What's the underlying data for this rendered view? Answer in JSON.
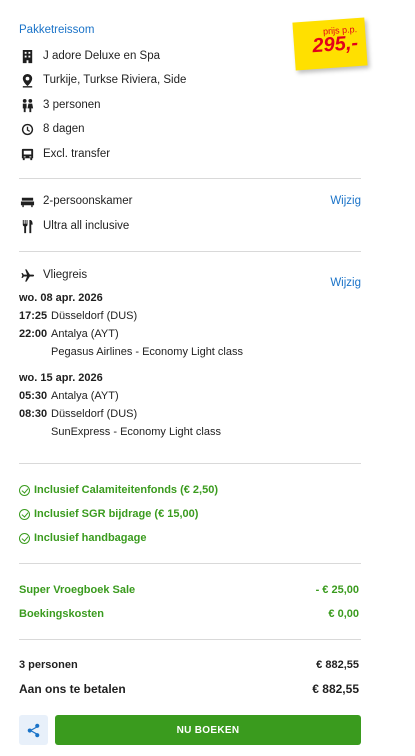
{
  "package": {
    "title": "Pakketreissom",
    "price_label": "prijs p.p.",
    "price": "295,-",
    "details": [
      {
        "icon": "building-icon",
        "text": "J adore Deluxe en Spa"
      },
      {
        "icon": "location-pin-icon",
        "text": "Turkije, Turkse Riviera, Side"
      },
      {
        "icon": "persons-icon",
        "text": "3 personen"
      },
      {
        "icon": "clock-icon",
        "text": "8 dagen"
      },
      {
        "icon": "bus-icon",
        "text": "Excl. transfer"
      }
    ]
  },
  "room": {
    "room_type": "2-persoonskamer",
    "board": "Ultra all inclusive",
    "change_label": "Wijzig"
  },
  "flight": {
    "label": "Vliegreis",
    "change_label": "Wijzig",
    "outbound": {
      "date": "wo. 08 apr. 2026",
      "dep_time": "17:25",
      "dep_airport": "Düsseldorf (DUS)",
      "arr_time": "22:00",
      "arr_airport": "Antalya (AYT)",
      "airline": "Pegasus Airlines - Economy Light class"
    },
    "return": {
      "date": "wo. 15 apr. 2026",
      "dep_time": "05:30",
      "dep_airport": "Antalya (AYT)",
      "arr_time": "08:30",
      "arr_airport": "Düsseldorf (DUS)",
      "airline": "SunExpress - Economy Light class"
    }
  },
  "inclusions": [
    "Inclusief Calamiteitenfonds (€ 2,50)",
    "Inclusief SGR bijdrage (€ 15,00)",
    "Inclusief handbagage"
  ],
  "discounts": {
    "sale_label": "Super Vroegboek Sale",
    "sale_value": "- € 25,00",
    "booking_label": "Boekingskosten",
    "booking_value": "€ 0,00"
  },
  "totals": {
    "persons_label": "3 personen",
    "persons_value": "€ 882,55",
    "pay_label": "Aan ons te betalen",
    "pay_value": "€ 882,55"
  },
  "actions": {
    "book_label": "NU BOEKEN",
    "share_icon": "share-icon"
  },
  "colors": {
    "accent_blue": "#1a73c8",
    "green": "#3a9b1e",
    "price_tag_yellow": "#ffe000",
    "price_red": "#e2001a"
  }
}
